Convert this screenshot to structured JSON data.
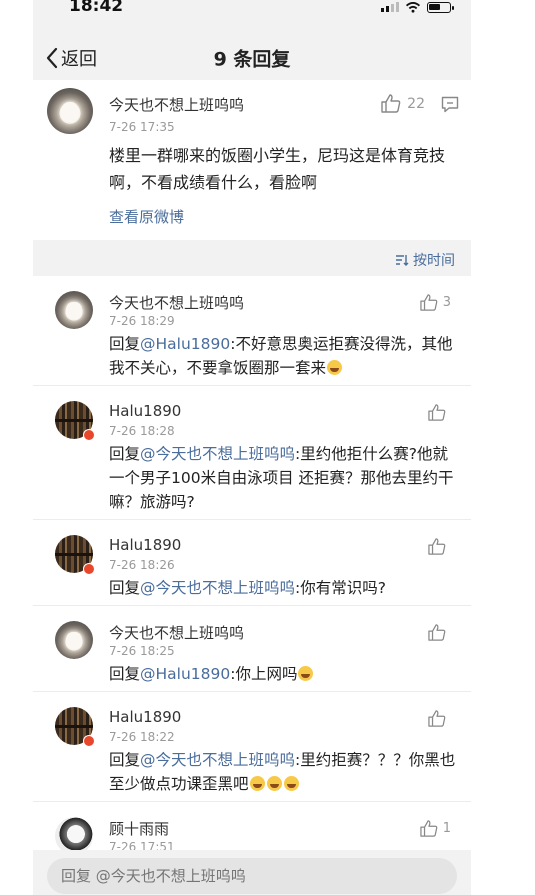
{
  "status": {
    "time": "18:42"
  },
  "nav": {
    "back_label": "返回",
    "title": "9 条回复"
  },
  "main_post": {
    "author": "今天也不想上班呜呜",
    "time": "7-26 17:35",
    "text": "楼里一群哪来的饭圈小学生，尼玛这是体育竞技啊，不看成绩看什么，看脸啊",
    "like_count": "22",
    "link_label": "查看原微博"
  },
  "sort": {
    "label": "按时间"
  },
  "comments": [
    {
      "author": "今天也不想上班呜呜",
      "time": "7-26 18:29",
      "reply_prefix": "回复",
      "mention": "@Halu1890",
      "text": ":不好意思奥运拒赛没得洗，其他我不关心，不要拿饭圈那一套来",
      "like_count": "3",
      "avatar": "dog"
    },
    {
      "author": "Halu1890",
      "time": "7-26 18:28",
      "reply_prefix": "回复",
      "mention": "@今天也不想上班呜呜",
      "text": ":里约他拒什么赛?他就一个男子100米自由泳项目  还拒赛？那他去里约干嘛？旅游吗?",
      "like_count": "",
      "avatar": "books"
    },
    {
      "author": "Halu1890",
      "time": "7-26 18:26",
      "reply_prefix": "回复",
      "mention": "@今天也不想上班呜呜",
      "text": ":你有常识吗?",
      "like_count": "",
      "avatar": "books"
    },
    {
      "author": "今天也不想上班呜呜",
      "time": "7-26 18:25",
      "reply_prefix": "回复",
      "mention": "@Halu1890",
      "text": ":你上网吗",
      "like_count": "",
      "avatar": "dog"
    },
    {
      "author": "Halu1890",
      "time": "7-26 18:22",
      "reply_prefix": "回复",
      "mention": "@今天也不想上班呜呜",
      "text": ":里约拒赛？？？你黑也至少做点功课歪黑吧",
      "like_count": "",
      "avatar": "books"
    },
    {
      "author": "顾十雨雨",
      "time": "7-26 17:51",
      "reply_prefix": "",
      "mention": "",
      "text": "",
      "like_count": "1",
      "avatar": "person"
    }
  ],
  "reply_bar": {
    "placeholder": "回复 @今天也不想上班呜呜"
  },
  "colors": {
    "link": "#4a6d9c",
    "background": "#f2f2f2",
    "card": "#ffffff"
  }
}
